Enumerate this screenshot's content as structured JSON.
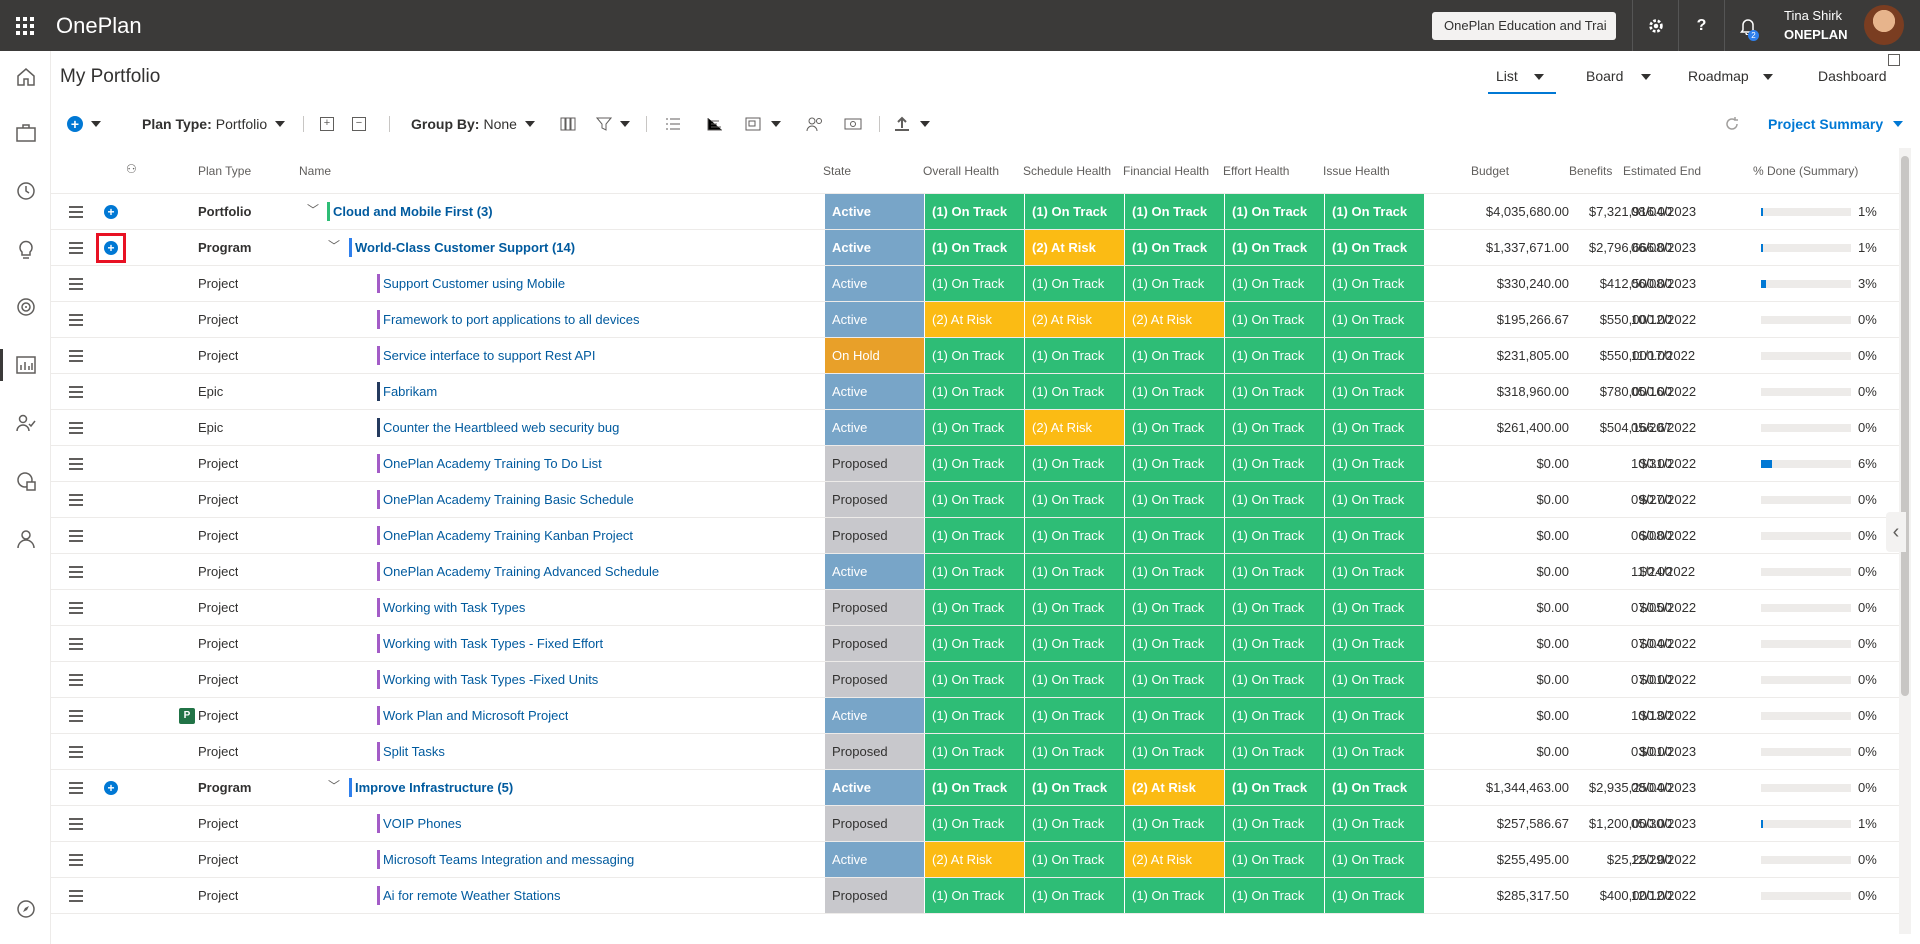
{
  "app": {
    "title": "OnePlan",
    "org_switcher": "OnePlan Education and Trai"
  },
  "user": {
    "name": "Tina Shirk",
    "org": "ONEPLAN",
    "notification_count": "2"
  },
  "page": {
    "title": "My Portfolio"
  },
  "views": {
    "list": "List",
    "board": "Board",
    "roadmap": "Roadmap",
    "dashboard": "Dashboard"
  },
  "toolbar": {
    "plan_type_label": "Plan Type:",
    "plan_type_value": "Portfolio",
    "group_by_label": "Group By:",
    "group_by_value": "None",
    "summary_view": "Project Summary"
  },
  "columns": {
    "plan_type": "Plan Type",
    "name": "Name",
    "state": "State",
    "overall": "Overall Health",
    "schedule": "Schedule Health",
    "financial": "Financial Health",
    "effort": "Effort Health",
    "issue": "Issue Health",
    "budget": "Budget",
    "benefits": "Benefits",
    "est_end": "Estimated End",
    "pct_done": "% Done (Summary)"
  },
  "colors": {
    "active": "#78a5c8",
    "proposed": "#c8c8cc",
    "on_hold": "#e8a029",
    "on_track": "#2ebd76",
    "at_risk": "#fbbb14",
    "portfolio_bar": "#2ebd76",
    "program_bar": "#2f80ed",
    "project_bar": "#a35cc7",
    "epic_bar": "#243a5e"
  },
  "rows": [
    {
      "plan_type": "Portfolio",
      "name": "Cloud and Mobile First (3)",
      "level": 0,
      "state": "Active",
      "overall": "(1) On Track",
      "schedule": "(1) On Track",
      "financial": "(1) On Track",
      "effort": "(1) On Track",
      "issue": "(1) On Track",
      "budget": "$4,035,680.00",
      "benefits": "$7,321,916.00",
      "end": "08/04/2023",
      "pct": "1%",
      "pct_value": 0.01
    },
    {
      "plan_type": "Program",
      "name": "World-Class Customer Support (14)",
      "level": 1,
      "state": "Active",
      "overall": "(1) On Track",
      "schedule": "(2) At Risk",
      "financial": "(1) On Track",
      "effort": "(1) On Track",
      "issue": "(1) On Track",
      "budget": "$1,337,671.00",
      "benefits": "$2,796,666.00",
      "end": "06/08/2023",
      "pct": "1%",
      "pct_value": 0.01
    },
    {
      "plan_type": "Project",
      "name": "Support Customer using Mobile",
      "level": 2,
      "state": "Active",
      "overall": "(1) On Track",
      "schedule": "(1) On Track",
      "financial": "(1) On Track",
      "effort": "(1) On Track",
      "issue": "(1) On Track",
      "budget": "$330,240.00",
      "benefits": "$412,500.00",
      "end": "06/08/2023",
      "pct": "3%",
      "pct_value": 0.03
    },
    {
      "plan_type": "Project",
      "name": "Framework to port applications to all devices",
      "level": 2,
      "state": "Active",
      "overall": "(2) At Risk",
      "schedule": "(2) At Risk",
      "financial": "(2) At Risk",
      "effort": "(1) On Track",
      "issue": "(1) On Track",
      "budget": "$195,266.67",
      "benefits": "$550,000.00",
      "end": "10/12/2022",
      "pct": "0%",
      "pct_value": 0
    },
    {
      "plan_type": "Project",
      "name": "Service interface to support Rest API",
      "level": 2,
      "state": "On Hold",
      "overall": "(1) On Track",
      "schedule": "(1) On Track",
      "financial": "(1) On Track",
      "effort": "(1) On Track",
      "issue": "(1) On Track",
      "budget": "$231,805.00",
      "benefits": "$550,000.00",
      "end": "11/17/2022",
      "pct": "0%",
      "pct_value": 0
    },
    {
      "plan_type": "Epic",
      "name": "Fabrikam",
      "level": 2,
      "state": "Active",
      "overall": "(1) On Track",
      "schedule": "(1) On Track",
      "financial": "(1) On Track",
      "effort": "(1) On Track",
      "issue": "(1) On Track",
      "budget": "$318,960.00",
      "benefits": "$780,000.00",
      "end": "05/16/2022",
      "pct": "0%",
      "pct_value": 0
    },
    {
      "plan_type": "Epic",
      "name": "Counter the Heartbleed web security bug",
      "level": 2,
      "state": "Active",
      "overall": "(1) On Track",
      "schedule": "(2) At Risk",
      "financial": "(1) On Track",
      "effort": "(1) On Track",
      "issue": "(1) On Track",
      "budget": "$261,400.00",
      "benefits": "$504,166.67",
      "end": "05/20/2022",
      "pct": "0%",
      "pct_value": 0
    },
    {
      "plan_type": "Project",
      "name": "OnePlan Academy Training To Do List",
      "level": 2,
      "state": "Proposed",
      "overall": "(1) On Track",
      "schedule": "(1) On Track",
      "financial": "(1) On Track",
      "effort": "(1) On Track",
      "issue": "(1) On Track",
      "budget": "$0.00",
      "benefits": "$0.00",
      "end": "10/31/2022",
      "pct": "6%",
      "pct_value": 0.06
    },
    {
      "plan_type": "Project",
      "name": "OnePlan Academy Training Basic Schedule",
      "level": 2,
      "state": "Proposed",
      "overall": "(1) On Track",
      "schedule": "(1) On Track",
      "financial": "(1) On Track",
      "effort": "(1) On Track",
      "issue": "(1) On Track",
      "budget": "$0.00",
      "benefits": "$0.00",
      "end": "09/27/2022",
      "pct": "0%",
      "pct_value": 0
    },
    {
      "plan_type": "Project",
      "name": "OnePlan Academy Training Kanban Project",
      "level": 2,
      "state": "Proposed",
      "overall": "(1) On Track",
      "schedule": "(1) On Track",
      "financial": "(1) On Track",
      "effort": "(1) On Track",
      "issue": "(1) On Track",
      "budget": "$0.00",
      "benefits": "$0.00",
      "end": "06/08/2022",
      "pct": "0%",
      "pct_value": 0
    },
    {
      "plan_type": "Project",
      "name": "OnePlan Academy Training Advanced Schedule",
      "level": 2,
      "state": "Active",
      "overall": "(1) On Track",
      "schedule": "(1) On Track",
      "financial": "(1) On Track",
      "effort": "(1) On Track",
      "issue": "(1) On Track",
      "budget": "$0.00",
      "benefits": "$0.00",
      "end": "11/24/2022",
      "pct": "0%",
      "pct_value": 0
    },
    {
      "plan_type": "Project",
      "name": "Working with Task Types",
      "level": 2,
      "state": "Proposed",
      "overall": "(1) On Track",
      "schedule": "(1) On Track",
      "financial": "(1) On Track",
      "effort": "(1) On Track",
      "issue": "(1) On Track",
      "budget": "$0.00",
      "benefits": "$0.00",
      "end": "07/05/2022",
      "pct": "0%",
      "pct_value": 0
    },
    {
      "plan_type": "Project",
      "name": "Working with Task Types - Fixed Effort",
      "level": 2,
      "state": "Proposed",
      "overall": "(1) On Track",
      "schedule": "(1) On Track",
      "financial": "(1) On Track",
      "effort": "(1) On Track",
      "issue": "(1) On Track",
      "budget": "$0.00",
      "benefits": "$0.00",
      "end": "07/04/2022",
      "pct": "0%",
      "pct_value": 0
    },
    {
      "plan_type": "Project",
      "name": "Working with Task Types -Fixed Units",
      "level": 2,
      "state": "Proposed",
      "overall": "(1) On Track",
      "schedule": "(1) On Track",
      "financial": "(1) On Track",
      "effort": "(1) On Track",
      "issue": "(1) On Track",
      "budget": "$0.00",
      "benefits": "$0.00",
      "end": "07/01/2022",
      "pct": "0%",
      "pct_value": 0
    },
    {
      "plan_type": "Project",
      "name": "Work Plan and Microsoft Project",
      "level": 2,
      "state": "Active",
      "overall": "(1) On Track",
      "schedule": "(1) On Track",
      "financial": "(1) On Track",
      "effort": "(1) On Track",
      "issue": "(1) On Track",
      "budget": "$0.00",
      "benefits": "$0.00",
      "end": "10/13/2022",
      "pct": "0%",
      "pct_value": 0,
      "has_project_icon": true
    },
    {
      "plan_type": "Project",
      "name": "Split Tasks",
      "level": 2,
      "state": "Proposed",
      "overall": "(1) On Track",
      "schedule": "(1) On Track",
      "financial": "(1) On Track",
      "effort": "(1) On Track",
      "issue": "(1) On Track",
      "budget": "$0.00",
      "benefits": "$0.00",
      "end": "03/01/2023",
      "pct": "0%",
      "pct_value": 0
    },
    {
      "plan_type": "Program",
      "name": "Improve Infrastructure (5)",
      "level": 1,
      "state": "Active",
      "overall": "(1) On Track",
      "schedule": "(1) On Track",
      "financial": "(2) At Risk",
      "effort": "(1) On Track",
      "issue": "(1) On Track",
      "budget": "$1,344,463.00",
      "benefits": "$2,935,250.00",
      "end": "08/04/2023",
      "pct": "0%",
      "pct_value": 0
    },
    {
      "plan_type": "Project",
      "name": "VOIP Phones",
      "level": 2,
      "state": "Proposed",
      "overall": "(1) On Track",
      "schedule": "(1) On Track",
      "financial": "(1) On Track",
      "effort": "(1) On Track",
      "issue": "(1) On Track",
      "budget": "$257,586.67",
      "benefits": "$1,200,000.00",
      "end": "05/30/2023",
      "pct": "1%",
      "pct_value": 0.01
    },
    {
      "plan_type": "Project",
      "name": "Microsoft Teams Integration and messaging",
      "level": 2,
      "state": "Active",
      "overall": "(2) At Risk",
      "schedule": "(1) On Track",
      "financial": "(2) At Risk",
      "effort": "(1) On Track",
      "issue": "(1) On Track",
      "budget": "$255,495.00",
      "benefits": "$25,250.00",
      "end": "12/29/2022",
      "pct": "0%",
      "pct_value": 0
    },
    {
      "plan_type": "Project",
      "name": "Ai for remote Weather Stations",
      "level": 2,
      "state": "Proposed",
      "overall": "(1) On Track",
      "schedule": "(1) On Track",
      "financial": "(1) On Track",
      "effort": "(1) On Track",
      "issue": "(1) On Track",
      "budget": "$285,317.50",
      "benefits": "$400,000.00",
      "end": "12/12/2022",
      "pct": "0%",
      "pct_value": 0
    }
  ]
}
